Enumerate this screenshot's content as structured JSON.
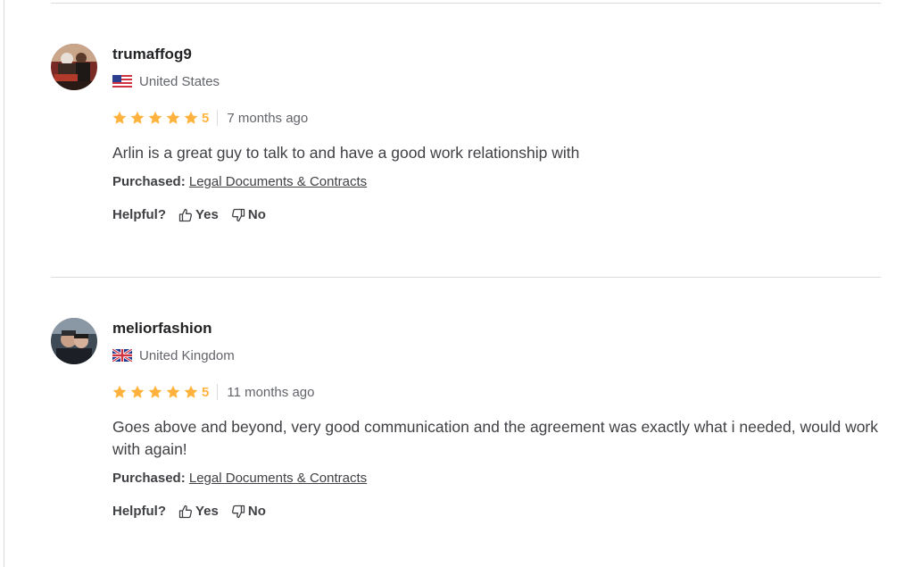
{
  "colors": {
    "star": "#ffb33e",
    "divider": "#dadbdd",
    "text": "#404145",
    "muted": "#62646a"
  },
  "reviews": [
    {
      "username": "trumaffog9",
      "country": "United States",
      "flag_icon": "us-flag-icon",
      "stars": 5,
      "score": "5",
      "time_ago": "7 months ago",
      "text": "Arlin is a great guy to talk to and have a good work relationship with",
      "purchased_label": "Purchased:",
      "purchased_item": "Legal Documents & Contracts",
      "helpful_label": "Helpful?",
      "yes_label": "Yes",
      "no_label": "No"
    },
    {
      "username": "meliorfashion",
      "country": "United Kingdom",
      "flag_icon": "uk-flag-icon",
      "stars": 5,
      "score": "5",
      "time_ago": "11 months ago",
      "text": "Goes above and beyond, very good communication and the agreement was exactly what i needed, would work with again!",
      "purchased_label": "Purchased:",
      "purchased_item": "Legal Documents & Contracts",
      "helpful_label": "Helpful?",
      "yes_label": "Yes",
      "no_label": "No"
    }
  ]
}
